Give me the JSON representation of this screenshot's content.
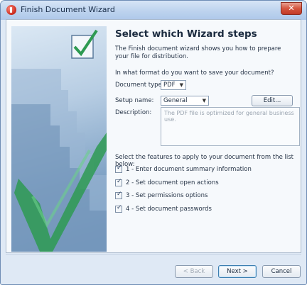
{
  "window": {
    "title": "Finish Document Wizard",
    "close_label": "✕"
  },
  "content": {
    "heading": "Select which Wizard steps",
    "description": "The Finish document wizard shows you how to prepare your file for distribution.",
    "format_question": "In what format do you want to save your document?",
    "document_type_label": "Document type:",
    "document_type_value": "PDF",
    "setup_name_label": "Setup name:",
    "setup_name_value": "General",
    "edit_button_label": "Edit...",
    "description_label": "Description:",
    "description_value": "The PDF file is optimized for general business use.",
    "features_label": "Select the features to apply to your document from the list below:",
    "features": [
      {
        "label": "1 - Enter document summary information",
        "checked": true
      },
      {
        "label": "2 - Set document open actions",
        "checked": true
      },
      {
        "label": "3 - Set permissions options",
        "checked": true
      },
      {
        "label": "4 - Set document passwords",
        "checked": true
      }
    ]
  },
  "buttons": {
    "back": "< Back",
    "next": "Next >",
    "cancel": "Cancel"
  },
  "colors": {
    "titlebar": "#bdd3ee",
    "checkmark_green": "#2e9a52",
    "side_panel": "#7fa2c5"
  }
}
